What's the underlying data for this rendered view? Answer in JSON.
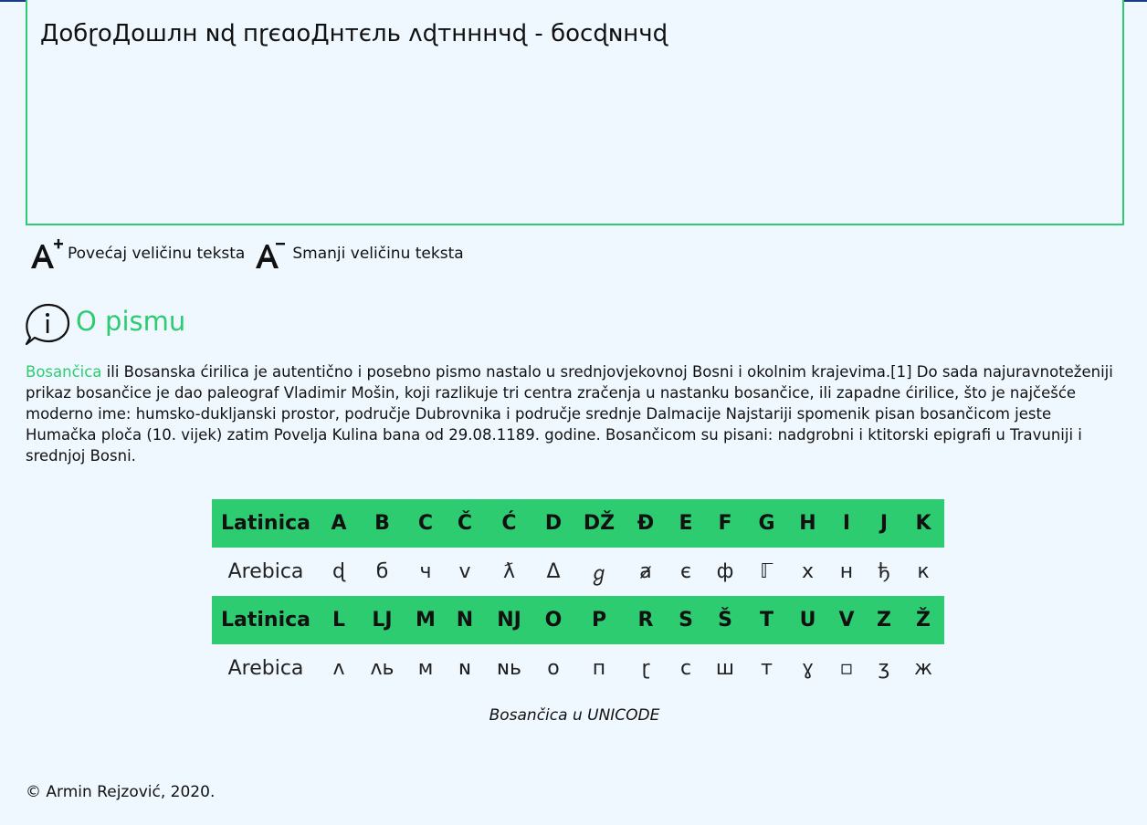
{
  "output": {
    "text": "ДобɽоДошлн ɴɖ пɽєɑоДнтєль ʌɖтнннчɖ - босɖɴнчɖ"
  },
  "font_controls": {
    "increase_label": "Povećaj veličinu teksta",
    "decrease_label": "Smanji veličinu teksta"
  },
  "section": {
    "title": "O pismu",
    "link_text": "Bosančica",
    "body": " ili Bosanska ćirilica je autentično i posebno pismo nastalo u srednjovjekovnoj Bosni i okolnim krajevima.[1] Do sada najuravnoteženiji prikaz bosančice je dao paleograf Vladimir Mošin, koji razlikuje tri centra zračenja u nastanku bosančice, ili zapadne ćirilice, što je najčešće moderno ime: humsko-dukljanski prostor, područje Dubrovnika i područje srednje Dalmacije Najstariji spomenik pisan bosančicom jeste Humačka ploča (10. vijek) zatim Povelja Kulina bana od 29.08.1189. godine. Bosančicom su pisani: nadgrobni i ktitorski epigrafi u Travuniji i srednjoj Bosni."
  },
  "table": {
    "latin_header": "Latinica",
    "arebica_header": "Arebica",
    "rows": [
      {
        "latin": [
          "A",
          "B",
          "C",
          "Č",
          "Ć",
          "D",
          "DŽ",
          "Đ",
          "E",
          "F",
          "G",
          "H",
          "I",
          "J",
          "K"
        ],
        "arebica": [
          "ɖ",
          "б",
          "ч",
          "ⅴ",
          "ƛ",
          "Δ",
          "ℊ",
          "ⱥ",
          "є",
          "ф",
          "ℾ",
          "х",
          "н",
          "ђ",
          "к"
        ]
      },
      {
        "latin": [
          "L",
          "LJ",
          "M",
          "N",
          "NJ",
          "O",
          "P",
          "R",
          "S",
          "Š",
          "T",
          "U",
          "V",
          "Z",
          "Ž"
        ],
        "arebica": [
          "ʌ",
          "ʌь",
          "м",
          "ɴ",
          "ɴь",
          "о",
          "п",
          "ɽ",
          "с",
          "ш",
          "т",
          "ɣ",
          "▫",
          "ʒ",
          "ж"
        ]
      }
    ]
  },
  "caption": "Bosančica u UNICODE",
  "footer": "© Armin Rejzović, 2020."
}
